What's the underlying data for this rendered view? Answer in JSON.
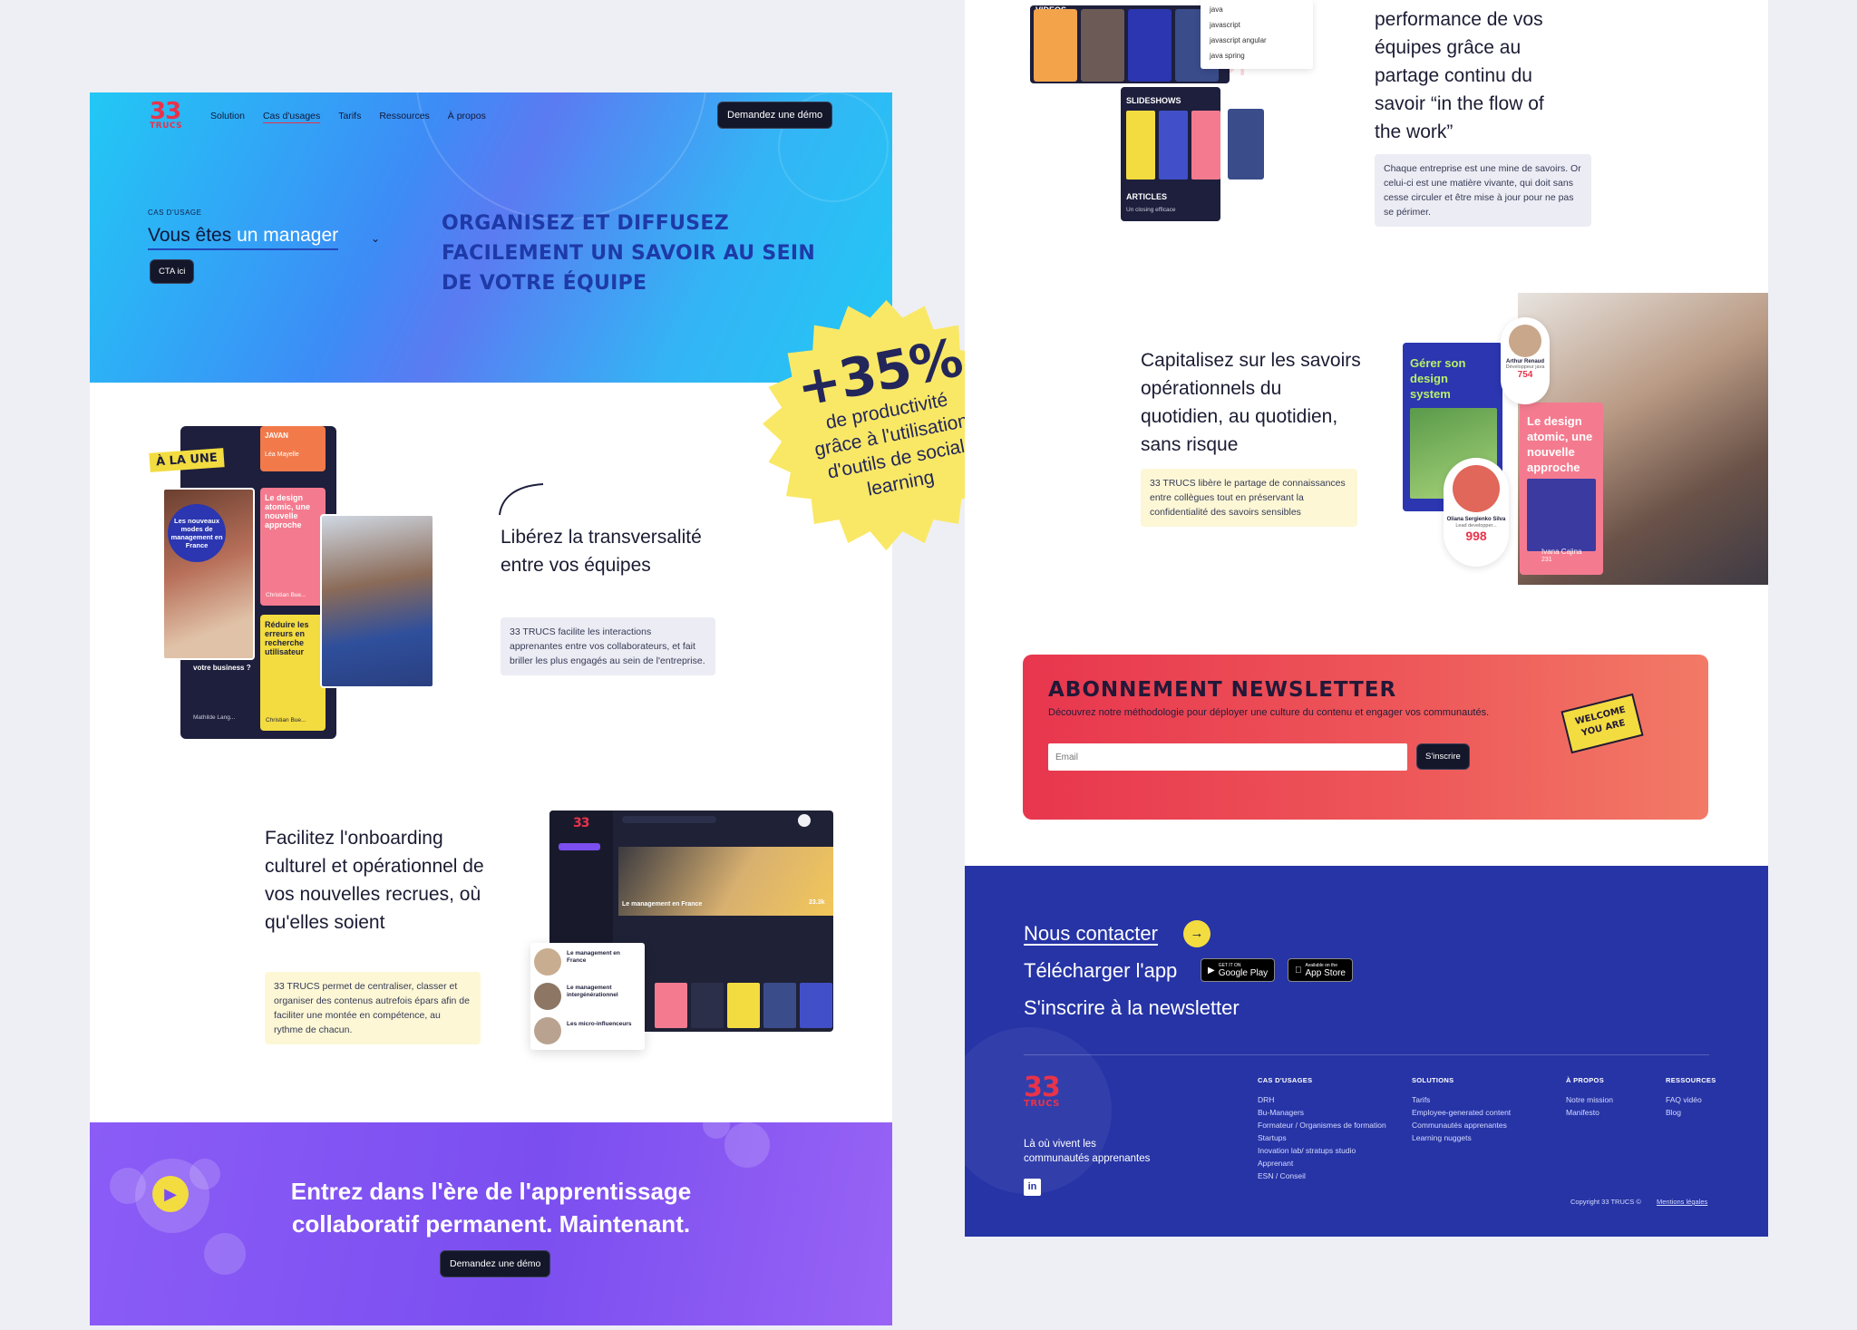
{
  "colors": {
    "brand_red": "#e8334a",
    "hero_blue": "#22c8f5",
    "title_blue": "#1e3aa8",
    "purple": "#8b5cf6",
    "footer_blue": "#2634a6",
    "stamp_yellow": "#f9e866"
  },
  "nav": {
    "logo_number": "33",
    "logo_text": "TRUCS",
    "items": [
      "Solution",
      "Cas d'usages",
      "Tarifs",
      "Ressources",
      "À propos"
    ],
    "demo_button": "Demandez une démo"
  },
  "hero": {
    "eyebrow": "CAS D'USAGE",
    "persona_prefix": "Vous êtes",
    "persona_value": "un manager",
    "cta": "CTA ici",
    "title": "ORGANISEZ ET DIFFUSEZ FACILEMENT UN SAVOIR AU SEIN DE VOTRE ÉQUIPE"
  },
  "stamp": {
    "value": "+35%",
    "line1": "de productivité",
    "line2": "grâce à l'utilisation",
    "line3": "d'outils de social",
    "line4": "learning"
  },
  "feature1": {
    "title": "Libérez la transversalité entre vos équipes",
    "text": "33 TRUCS facilite les interactions apprenantes entre vos collaborateurs, et fait briller les plus engagés au sein de l'entreprise.",
    "badge": "À LA UNE",
    "cards": [
      "Les nouveaux modes de management en France",
      "Le design atomic, une nouvelle approche",
      "Réduire les erreurs en recherche utilisateur",
      "votre business ?"
    ],
    "authors": [
      "Mathilde Lang...",
      "Christian Bue...",
      "Christian Bue...",
      "Léa Mayelle"
    ],
    "top_label": "JAVAN"
  },
  "feature2": {
    "title": "Facilitez l'onboarding culturel et opérationnel de vos nouvelles recrues, où qu'elles soient",
    "text": "33 TRUCS permet de centraliser, classer et organiser des contenus autrefois épars afin de faciliter une montée en compétence, au rythme de chacun.",
    "app_title": "Le management en France",
    "list": [
      "Le management en France",
      "Le management intergénérationnel",
      "Les micro-influenceurs"
    ],
    "count": "23.3k"
  },
  "cta_band": {
    "line1": "Entrez dans l'ère de l'apprentissage",
    "line2": "collaboratif permanent. Maintenant.",
    "button": "Demandez une démo"
  },
  "right_top": {
    "title_lines": [
      "performance de vos",
      "équipes grâce au",
      "partage continu du",
      "savoir  “in the flow of",
      "the work”"
    ],
    "text": "Chaque entreprise est une mine de savoirs. Or celui-ci est une matière vivante, qui doit sans cesse circuler et être mise à jour pour ne pas se périmer.",
    "tags": [
      "java",
      "javascript",
      "javascript angular",
      "java spring"
    ],
    "sections": [
      "VIDEOS",
      "SLIDESHOWS",
      "ARTICLES"
    ],
    "article_line": "Un closing efficace"
  },
  "feature3": {
    "title": "Capitalisez sur les savoirs opérationnels du quotidien, au quotidien, sans risque",
    "text": "33 TRUCS libère le partage de connaissances entre collègues tout en préservant la confidentialité des savoirs sensibles",
    "card1": "Gérer son design system",
    "card2": "Le design atomic, une nouvelle approche",
    "person1": {
      "name": "Arthur Renaud",
      "role": "Développeur java",
      "score": "754"
    },
    "person2": {
      "name": "Oliana Sergienko Silva",
      "role": "Lead developper...",
      "score": "998"
    },
    "person3": {
      "name": "Ivana Cajina",
      "score": "231"
    }
  },
  "newsletter": {
    "title": "ABONNEMENT NEWSLETTER",
    "desc": "Découvrez notre méthodologie pour déployer une culture du contenu et engager vos communautés.",
    "placeholder": "Email",
    "button": "S'inscrire",
    "sticker_line1": "WELCOME",
    "sticker_line2": "YOU ARE"
  },
  "footer": {
    "contact": "Nous contacter",
    "download": "Télécharger l'app",
    "newsletter": "S'inscrire à la newsletter",
    "google_small": "GET IT ON",
    "google": "Google Play",
    "apple_small": "Available on the",
    "apple": "App Store",
    "tagline_1": "Là où vivent les",
    "tagline_2": "communautés apprenantes",
    "columns": [
      {
        "title": "CAS D'USAGES",
        "items": [
          "DRH",
          "Bu-Managers",
          "Formateur / Organismes de formation",
          "Startups",
          "Inovation lab/ stratups studio",
          "Apprenant",
          "ESN / Conseil"
        ]
      },
      {
        "title": "SOLUTIONS",
        "items": [
          "Tarifs",
          "Employee-generated content",
          "Communautés apprenantes",
          "Learning nuggets"
        ]
      },
      {
        "title": "À PROPOS",
        "items": [
          "Notre mission",
          "Manifesto"
        ]
      },
      {
        "title": "RESSOURCES",
        "items": [
          "FAQ vidéo",
          "Blog"
        ]
      }
    ],
    "copyright": "Copyright 33 TRUCS ©",
    "legal": "Mentions légales"
  }
}
